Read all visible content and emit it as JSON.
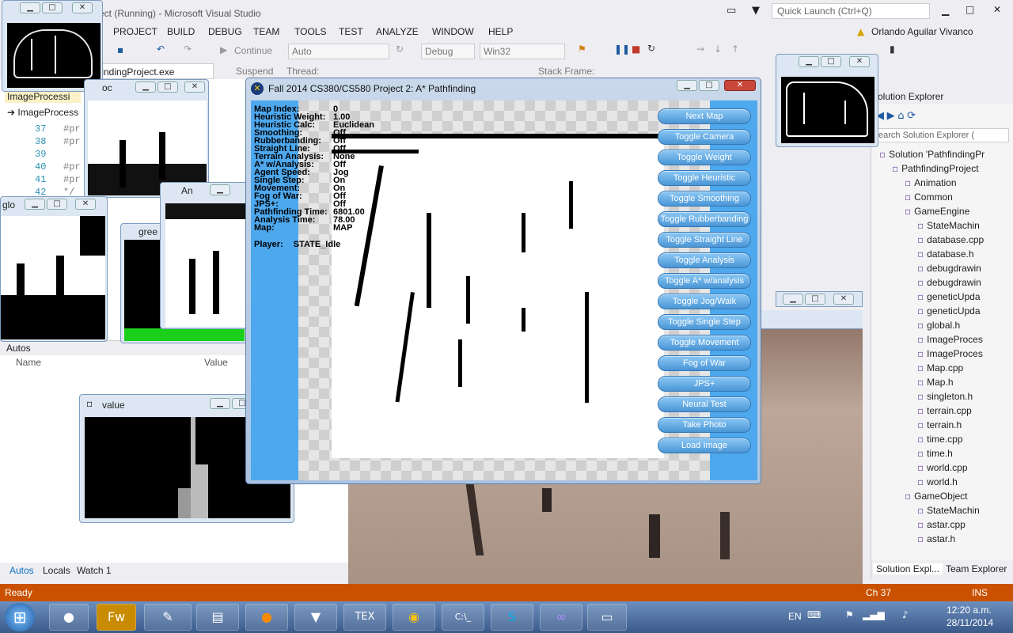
{
  "vs": {
    "title": "ect (Running) - Microsoft Visual Studio",
    "quick_launch_placeholder": "Quick Launch (Ctrl+Q)",
    "user": "Orlando Aguilar Vivanco",
    "menu": [
      "PROJECT",
      "BUILD",
      "DEBUG",
      "TEAM",
      "TOOLS",
      "TEST",
      "ANALYZE",
      "WINDOW",
      "HELP"
    ],
    "toolbar": {
      "continue": "Continue",
      "config_auto": "Auto",
      "config_debug": "Debug",
      "platform": "Win32",
      "process": "findingProject.exe",
      "suspend": "Suspend",
      "thread": "Thread:",
      "stack_frame": "Stack Frame:"
    },
    "editor": {
      "tab": "ImageProcessi",
      "file_tab": "ImageProcess",
      "lines": [
        {
          "num": "37",
          "code": "#pr"
        },
        {
          "num": "38",
          "code": "#pr"
        },
        {
          "num": "39",
          "code": ""
        },
        {
          "num": "40",
          "code": "#pr"
        },
        {
          "num": "41",
          "code": "#pr"
        },
        {
          "num": "42",
          "code": "*/"
        }
      ]
    },
    "autos": {
      "title": "Autos",
      "col_name": "Name",
      "col_value": "Value",
      "tabs": [
        "Autos",
        "Locals",
        "Watch 1"
      ]
    },
    "status": {
      "left": "Ready",
      "ch": "Ch 37",
      "ins": "INS"
    },
    "solution": {
      "title": "olution Explorer",
      "search": "earch Solution Explorer (",
      "items": [
        {
          "label": "Solution 'PathfindingPr",
          "indent": 0
        },
        {
          "label": "PathfindingProject",
          "indent": 1
        },
        {
          "label": "Animation",
          "indent": 2
        },
        {
          "label": "Common",
          "indent": 2
        },
        {
          "label": "GameEngine",
          "indent": 2
        },
        {
          "label": "StateMachin",
          "indent": 3
        },
        {
          "label": "database.cpp",
          "indent": 3
        },
        {
          "label": "database.h",
          "indent": 3
        },
        {
          "label": "debugdrawin",
          "indent": 3
        },
        {
          "label": "debugdrawin",
          "indent": 3
        },
        {
          "label": "geneticUpda",
          "indent": 3
        },
        {
          "label": "geneticUpda",
          "indent": 3
        },
        {
          "label": "global.h",
          "indent": 3
        },
        {
          "label": "ImageProces",
          "indent": 3
        },
        {
          "label": "ImageProces",
          "indent": 3
        },
        {
          "label": "Map.cpp",
          "indent": 3
        },
        {
          "label": "Map.h",
          "indent": 3
        },
        {
          "label": "singleton.h",
          "indent": 3
        },
        {
          "label": "terrain.cpp",
          "indent": 3
        },
        {
          "label": "terrain.h",
          "indent": 3
        },
        {
          "label": "time.cpp",
          "indent": 3
        },
        {
          "label": "time.h",
          "indent": 3
        },
        {
          "label": "world.cpp",
          "indent": 3
        },
        {
          "label": "world.h",
          "indent": 3
        },
        {
          "label": "GameObject",
          "indent": 2
        },
        {
          "label": "StateMachin",
          "indent": 3
        },
        {
          "label": "astar.cpp",
          "indent": 3
        },
        {
          "label": "astar.h",
          "indent": 3
        }
      ],
      "tabs": [
        "Solution Expl...",
        "Team Explorer"
      ]
    }
  },
  "cv_windows": {
    "top_left": "",
    "occ": "oc",
    "glo": "glo",
    "an": "An",
    "gree": "gree",
    "value": "value",
    "right_top": ""
  },
  "astar": {
    "title": "Fall 2014 CS380/CS580 Project 2: A* Pathfinding",
    "info": [
      {
        "k": "Map Index:",
        "v": "0"
      },
      {
        "k": "Heuristic Weight:",
        "v": "1.00"
      },
      {
        "k": "Heuristic Calc:",
        "v": "Euclidean"
      },
      {
        "k": "Smoothing:",
        "v": "Off"
      },
      {
        "k": "Rubberbanding:",
        "v": "Off"
      },
      {
        "k": "Straight Line:",
        "v": "Off"
      },
      {
        "k": "Terrain Analysis:",
        "v": "None"
      },
      {
        "k": "A* w/Analysis:",
        "v": "Off"
      },
      {
        "k": "Agent Speed:",
        "v": "Jog"
      },
      {
        "k": "Single Step:",
        "v": "On"
      },
      {
        "k": "Movement:",
        "v": "On"
      },
      {
        "k": "Fog of War:",
        "v": "Off"
      },
      {
        "k": "JPS+:",
        "v": "Off"
      },
      {
        "k": "Pathfinding Time:",
        "v": "6801.00"
      },
      {
        "k": "Analysis Time:",
        "v": "78.00"
      },
      {
        "k": "Map:",
        "v": "MAP"
      }
    ],
    "player_label": "Player:",
    "player_value": "STATE_Idle",
    "buttons": [
      "Next Map",
      "Toggle Camera",
      "Toggle Weight",
      "Toggle Heuristic",
      "Toggle Smoothing",
      "Toggle Rubberbanding",
      "Toggle Straight Line",
      "Toggle Analysis",
      "Toggle A* w/analysis",
      "Toggle Jog/Walk",
      "Toggle Single Step",
      "Toggle Movement",
      "Fog of War",
      "JPS+",
      "Neural Test",
      "Take Photo",
      "Load Image"
    ]
  },
  "taskbar": {
    "lang": "EN",
    "time": "12:20 a.m.",
    "date": "28/11/2014",
    "apps": [
      "start-orb",
      "media-icon",
      "fw-icon",
      "folder-icon",
      "explorer-icon",
      "firefox-icon",
      "badge-icon",
      "tex-icon",
      "chrome-icon",
      "cmd-icon",
      "skype-icon",
      "vs-icon",
      "window-icon"
    ],
    "fw_label": "Fw",
    "tex_label": "TEX",
    "cmd_label": "C:\\_"
  },
  "colors": {
    "status_bar": "#ca5100",
    "astar_bg": "#4ea8ee",
    "button_blue": "#4a96d6"
  }
}
